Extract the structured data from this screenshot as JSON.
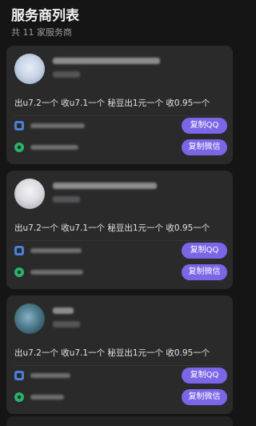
{
  "header": {
    "title": "服务商列表",
    "subtitle": "共 11 家服务商"
  },
  "colors": {
    "background": "#151515",
    "card": "#2a2a2b",
    "accent": "#7a66e6",
    "qq_icon": "#4a7fd6",
    "wechat_icon": "#27b46a"
  },
  "cards": [
    {
      "description": "出u7.2一个 收u7.1一个 秘豆出1元一个 收0.95一个",
      "qq_button": "复制QQ",
      "wechat_button": "复制微信"
    },
    {
      "description": "出u7.2一个 收u7.1一个 秘豆出1元一个 收0.95一个",
      "qq_button": "复制QQ",
      "wechat_button": "复制微信"
    },
    {
      "description": "出u7.2一个 收u7.1一个 秘豆出1元一个 收0.95一个",
      "qq_button": "复制QQ",
      "wechat_button": "复制微信"
    }
  ]
}
